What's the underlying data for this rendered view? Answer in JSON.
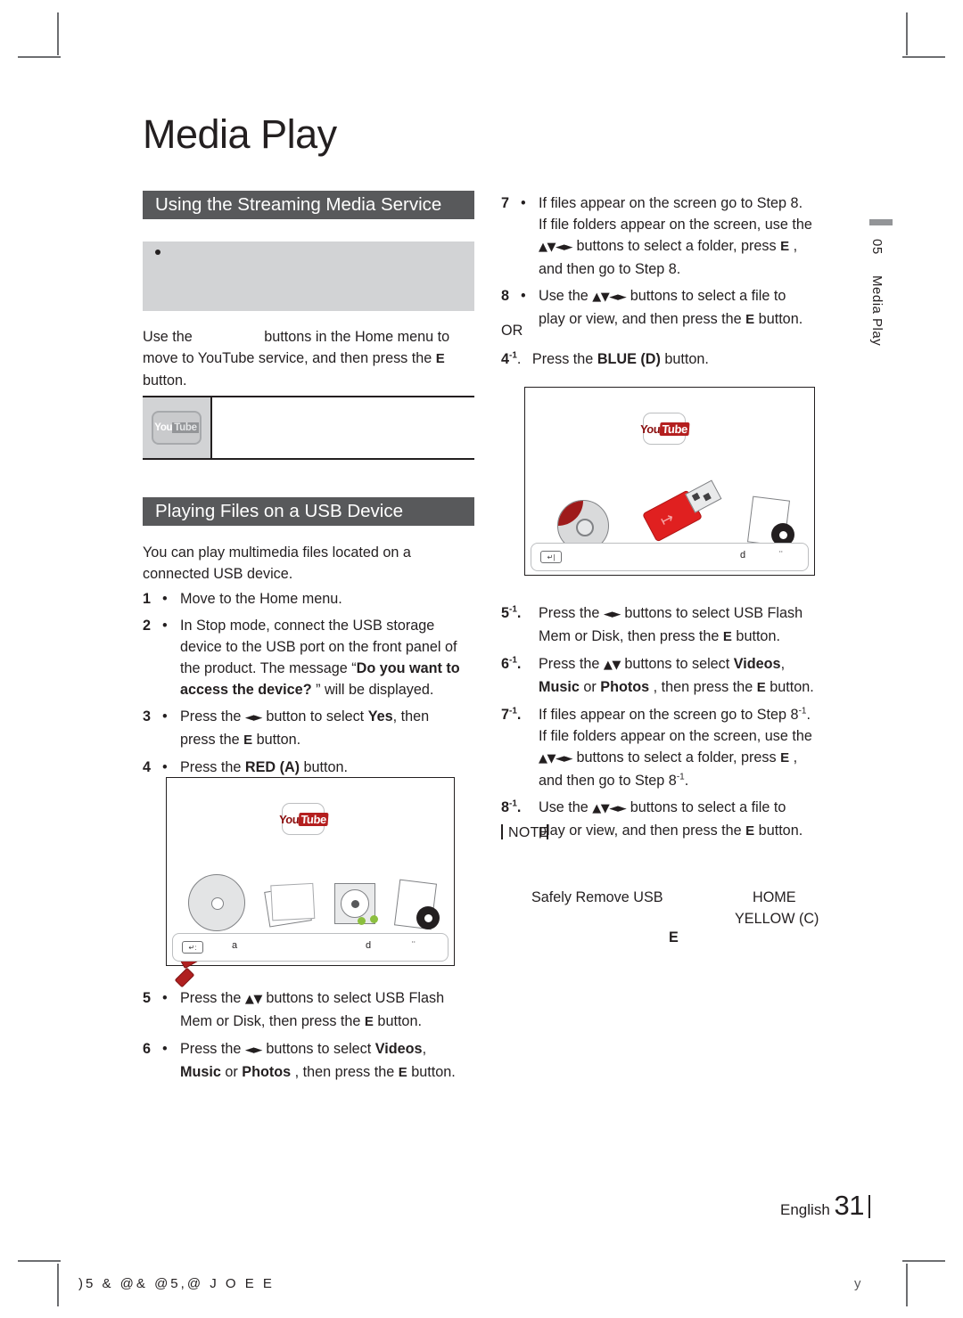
{
  "page": {
    "title": "Media Play",
    "chapter_number": "05",
    "chapter_name": "Media Play",
    "footer_language": "English",
    "footer_page_number": "31",
    "footer_left_garbled": ")5 &    @&    @5,@     J O E E",
    "footer_right_garbled": "y"
  },
  "sections": [
    {
      "id": "streaming",
      "heading": "Using the Streaming Media Service"
    },
    {
      "id": "usb",
      "heading": "Playing Files on a USB Device"
    }
  ],
  "streaming": {
    "note_block_bullet": "•",
    "paragraph": {
      "l1_a": "Use the",
      "l1_b": "buttons in the Home menu to",
      "l2_a": "move to YouTube service, and then press the",
      "l2_e": "E",
      "l3": "button."
    },
    "table": {
      "logo_alt": "YouTube",
      "logo_you": "You",
      "logo_tube": "Tube"
    }
  },
  "usb": {
    "intro_l1": "You can play multimedia files located on a",
    "intro_l2": "connected USB device.",
    "steps": [
      {
        "num": "1",
        "lines": [
          [
            {
              "t": "Move to the Home menu."
            }
          ]
        ]
      },
      {
        "num": "2",
        "lines": [
          [
            {
              "t": "In Stop mode, connect the USB storage"
            }
          ],
          [
            {
              "t": "device to the USB port on the front panel of"
            }
          ],
          [
            {
              "t": "the product. The message “"
            },
            {
              "t": "Do you want to",
              "b": true
            }
          ],
          [
            {
              "t": "access the device?",
              "b": true
            },
            {
              "t": " ” will be displayed."
            }
          ]
        ]
      },
      {
        "num": "3",
        "lines": [
          [
            {
              "t": "Press the "
            },
            {
              "t": "◄►",
              "s": true
            },
            {
              "t": " button to select "
            },
            {
              "t": "Yes",
              "b": true
            },
            {
              "t": ", then"
            }
          ],
          [
            {
              "t": "press the "
            },
            {
              "t": "E",
              "e": true
            },
            {
              "t": "   button."
            }
          ]
        ]
      },
      {
        "num": "4",
        "lines": [
          [
            {
              "t": "Press the "
            },
            {
              "t": "RED (A)",
              "b": true
            },
            {
              "t": " button."
            }
          ]
        ]
      }
    ],
    "steps_after_image": [
      {
        "num": "5",
        "lines": [
          [
            {
              "t": "Press the "
            },
            {
              "t": "▲▼",
              "s": true
            },
            {
              "t": " buttons to select USB Flash"
            }
          ],
          [
            {
              "t": "Mem or Disk, then press the "
            },
            {
              "t": "E",
              "e": true
            },
            {
              "t": "   button."
            }
          ]
        ]
      },
      {
        "num": "6",
        "lines": [
          [
            {
              "t": "Press the "
            },
            {
              "t": "◄►",
              "s": true
            },
            {
              "t": " buttons to select "
            },
            {
              "t": "Videos",
              "b": true
            },
            {
              "t": ","
            }
          ],
          [
            {
              "t": "Music",
              "b": true
            },
            {
              "t": " or "
            },
            {
              "t": "Photos",
              "b": true
            },
            {
              "t": " , then press the "
            },
            {
              "t": "E",
              "e": true
            },
            {
              "t": "   button."
            }
          ]
        ]
      }
    ],
    "screen_mock_left": {
      "yt_you": "You",
      "yt_tube": "Tube",
      "bottom_key": "↵:",
      "bottom_labels": [
        "a",
        "d",
        "¨"
      ]
    }
  },
  "right_column": {
    "steps_top": [
      {
        "num": "7",
        "lines": [
          [
            {
              "t": "If files appear on the screen go to Step 8."
            }
          ],
          [
            {
              "t": "If file folders appear on the screen, use the"
            }
          ],
          [
            {
              "t": "▲▼◄►",
              "s": true
            },
            {
              "t": " buttons to select a folder, press "
            },
            {
              "t": "E",
              "e": true
            },
            {
              "t": "  ,"
            }
          ],
          [
            {
              "t": "and then go to Step 8."
            }
          ]
        ]
      },
      {
        "num": "8",
        "lines": [
          [
            {
              "t": "Use the "
            },
            {
              "t": "▲▼◄►",
              "s": true
            },
            {
              "t": " buttons to select a file to"
            }
          ],
          [
            {
              "t": "play or view, and then press the "
            },
            {
              "t": "E",
              "e": true
            },
            {
              "t": "   button."
            }
          ]
        ]
      }
    ],
    "or_label": "OR",
    "step_4_1": {
      "num": "4",
      "sup": "-1",
      "text_a": "Press the ",
      "text_bold": "BLUE (D)",
      "text_b": " button."
    },
    "screen_mock_right": {
      "yt_you": "You",
      "yt_tube": "Tube",
      "bottom_key": "↵|",
      "bottom_labels": [
        "d",
        "¨"
      ]
    },
    "steps_bottom": [
      {
        "num": "5",
        "sup": "-1",
        "lines": [
          [
            {
              "t": "Press the "
            },
            {
              "t": "◄►",
              "s": true
            },
            {
              "t": " buttons to select USB Flash"
            }
          ],
          [
            {
              "t": "Mem or Disk, then press the "
            },
            {
              "t": "E",
              "e": true
            },
            {
              "t": "   button."
            }
          ]
        ]
      },
      {
        "num": "6",
        "sup": "-1",
        "lines": [
          [
            {
              "t": "Press the "
            },
            {
              "t": "▲▼",
              "s": true
            },
            {
              "t": " buttons to select "
            },
            {
              "t": "Videos",
              "b": true
            },
            {
              "t": ","
            }
          ],
          [
            {
              "t": "Music",
              "b": true
            },
            {
              "t": " or "
            },
            {
              "t": "Photos",
              "b": true
            },
            {
              "t": " , then press the "
            },
            {
              "t": "E",
              "e": true
            },
            {
              "t": "   button."
            }
          ]
        ]
      },
      {
        "num": "7",
        "sup": "-1",
        "lines": [
          [
            {
              "t": "If files appear on the screen go to Step 8"
            },
            {
              "t": "-1",
              "sup": true
            },
            {
              "t": "."
            }
          ],
          [
            {
              "t": "If file folders appear on the screen, use the"
            }
          ],
          [
            {
              "t": "▲▼◄►",
              "s": true
            },
            {
              "t": " buttons to select a folder, press "
            },
            {
              "t": "E",
              "e": true
            },
            {
              "t": "  ,"
            }
          ],
          [
            {
              "t": "and then go to Step 8"
            },
            {
              "t": "-1",
              "sup": true
            },
            {
              "t": "."
            }
          ]
        ]
      },
      {
        "num": "8",
        "sup": "-1",
        "lines": [
          [
            {
              "t": "Use the "
            },
            {
              "t": "▲▼◄►",
              "s": true
            },
            {
              "t": " buttons to select a file to"
            }
          ],
          [
            {
              "t": "play or view, and then press the "
            },
            {
              "t": "E",
              "e": true
            },
            {
              "t": "   button."
            }
          ]
        ]
      }
    ],
    "note": {
      "heading": "NOTE",
      "fragment_1": "Safely Remove USB",
      "fragment_2": "HOME",
      "fragment_3": "YELLOW (C)",
      "fragment_4": "E"
    }
  }
}
